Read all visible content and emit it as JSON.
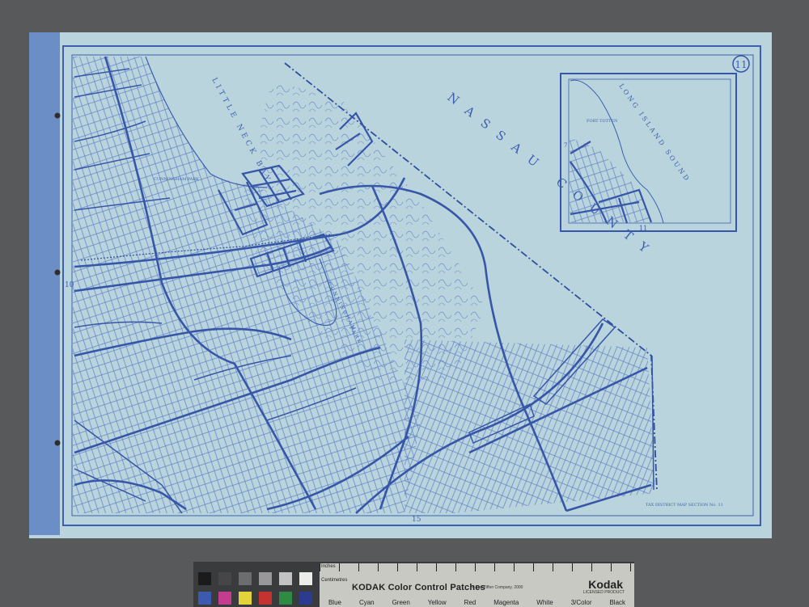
{
  "map": {
    "sheet_number": "11",
    "labels": {
      "bay": "LITTLE NECK BAY",
      "county": "NASSAU COUNTY",
      "sound": "LONG ISLAND SOUND",
      "fort": "FORT TOTTEN",
      "park_top": "CUNNINGHAM PARK",
      "park_mid": "CUNNINGHAM",
      "park_low": "PARK",
      "inset_edge": "11"
    },
    "margin_numbers": {
      "left": "10",
      "bottom": "15",
      "inset_left": "7"
    },
    "legend_line": "TAX DISTRICT MAP SECTION No. 11"
  },
  "kodak": {
    "inches": "Inches",
    "centimetres": "Centimetres",
    "title": "KODAK Color Control Patches",
    "copyright": "© The Tiffen Company, 2000",
    "brand": "Kodak",
    "licensed": "LICENSED PRODUCT",
    "patch_names": [
      "Blue",
      "Cyan",
      "Green",
      "Yellow",
      "Red",
      "Magenta",
      "White",
      "3/Color",
      "Black"
    ],
    "swatch_colors": [
      "#1b1b1c",
      "#464648",
      "#6d6d6f",
      "#98989a",
      "#c2c2c4",
      "#ececea",
      "#3c5bb0",
      "#c33c8e",
      "#e4d23a",
      "#c4332f",
      "#2f8a44",
      "#2b3b8f"
    ]
  },
  "colors": {
    "paper": "#b9d4dc",
    "ink": "#3d5fb0",
    "binding": "#6c8ec7",
    "background": "#58595b"
  }
}
